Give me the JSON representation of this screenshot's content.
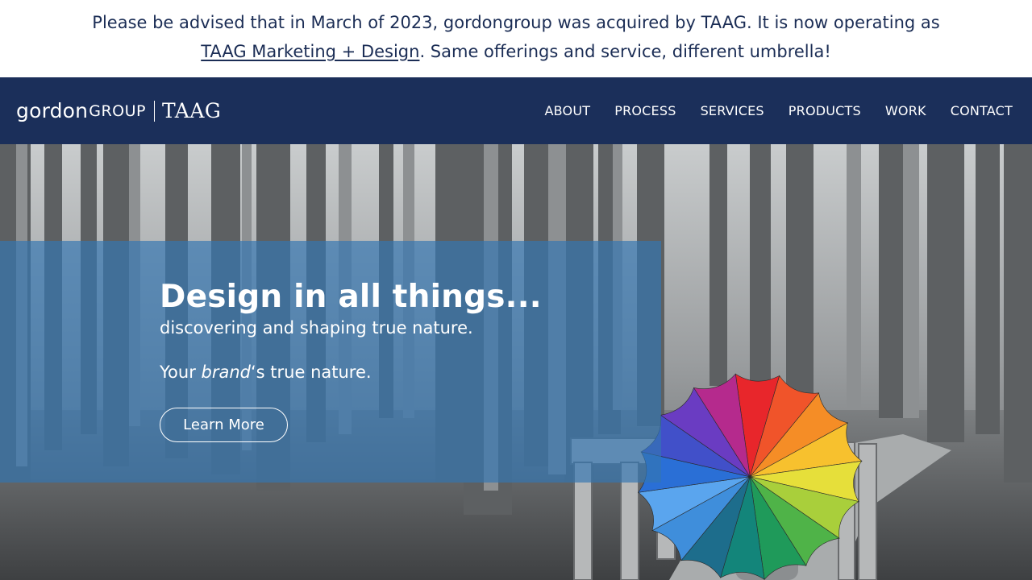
{
  "notice": {
    "line1": "Please be advised that in March of 2023, gordongroup was acquired by TAAG. It is now operating as",
    "link_text": "TAAG Marketing + Design",
    "line2_rest": ". Same offerings and service, different umbrella!"
  },
  "header": {
    "logo": {
      "gordon": "gordon",
      "group": "GROUP",
      "taag": "TAAG"
    },
    "nav": [
      "ABOUT",
      "PROCESS",
      "SERVICES",
      "PRODUCTS",
      "WORK",
      "CONTACT"
    ]
  },
  "hero": {
    "title": "Design in all things...",
    "subtitle": "discovering and shaping true nature.",
    "tagline_prefix": "Your ",
    "tagline_emphasis": "brand",
    "tagline_suffix": "‘s true nature.",
    "cta_label": "Learn More",
    "umbrella_colors": [
      "#e8262b",
      "#f0542a",
      "#f58d26",
      "#f7c12e",
      "#e6df3a",
      "#a9cf3b",
      "#4fb348",
      "#1f9a5a",
      "#13857a",
      "#1d6d8c",
      "#3f8edb",
      "#5aa5ee",
      "#2a6fd6",
      "#4150c9",
      "#6a3cc2",
      "#b52a8d"
    ]
  },
  "colors": {
    "header_bg": "#1b2f5a",
    "text_dark": "#1b2d55",
    "overlay": "#3476b2"
  }
}
